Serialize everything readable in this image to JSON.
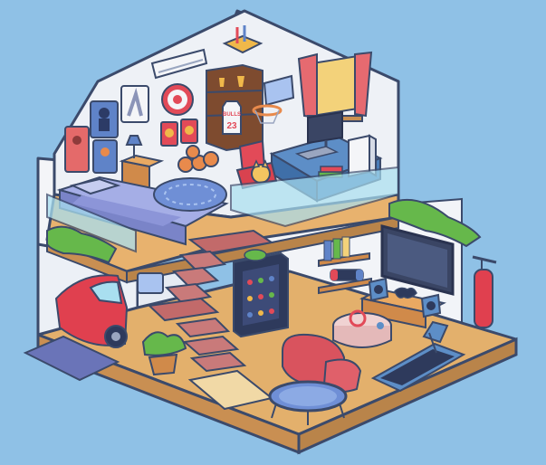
{
  "scene": {
    "background": "#8fc1e6",
    "jersey": {
      "team": "BULLS",
      "number": "23"
    }
  },
  "colors": {
    "wall": "#f4f5f8",
    "wall_outline": "#3b4a6b",
    "floor_wood": "#e3b06c",
    "floor_edge": "#b9844a",
    "carpet": "#6f8fd6",
    "bed": "#8c95d8",
    "car": "#e0404f",
    "stair": "#c26a6a",
    "sofa": "#d9535e",
    "fridge": "#2e3a5c",
    "tv": "#3a4564",
    "plants": "#66b84b",
    "curtain": "#e66a70",
    "desk": "#5d8ec7",
    "glass": "#a9dff0"
  },
  "icons": [
    "poster-icon",
    "lamp-icon",
    "target-icon",
    "trophy-icon",
    "basketball-icon",
    "hoop-icon",
    "chair-icon",
    "monitor-icon",
    "pc-icon",
    "books-icon",
    "plant-icon",
    "car-icon",
    "fridge-icon",
    "tv-icon",
    "gamepad-icon",
    "speaker-icon",
    "punching-bag-icon",
    "treadmill-icon",
    "trampoline-icon",
    "sofa-icon",
    "rug-icon",
    "ac-unit-icon"
  ]
}
